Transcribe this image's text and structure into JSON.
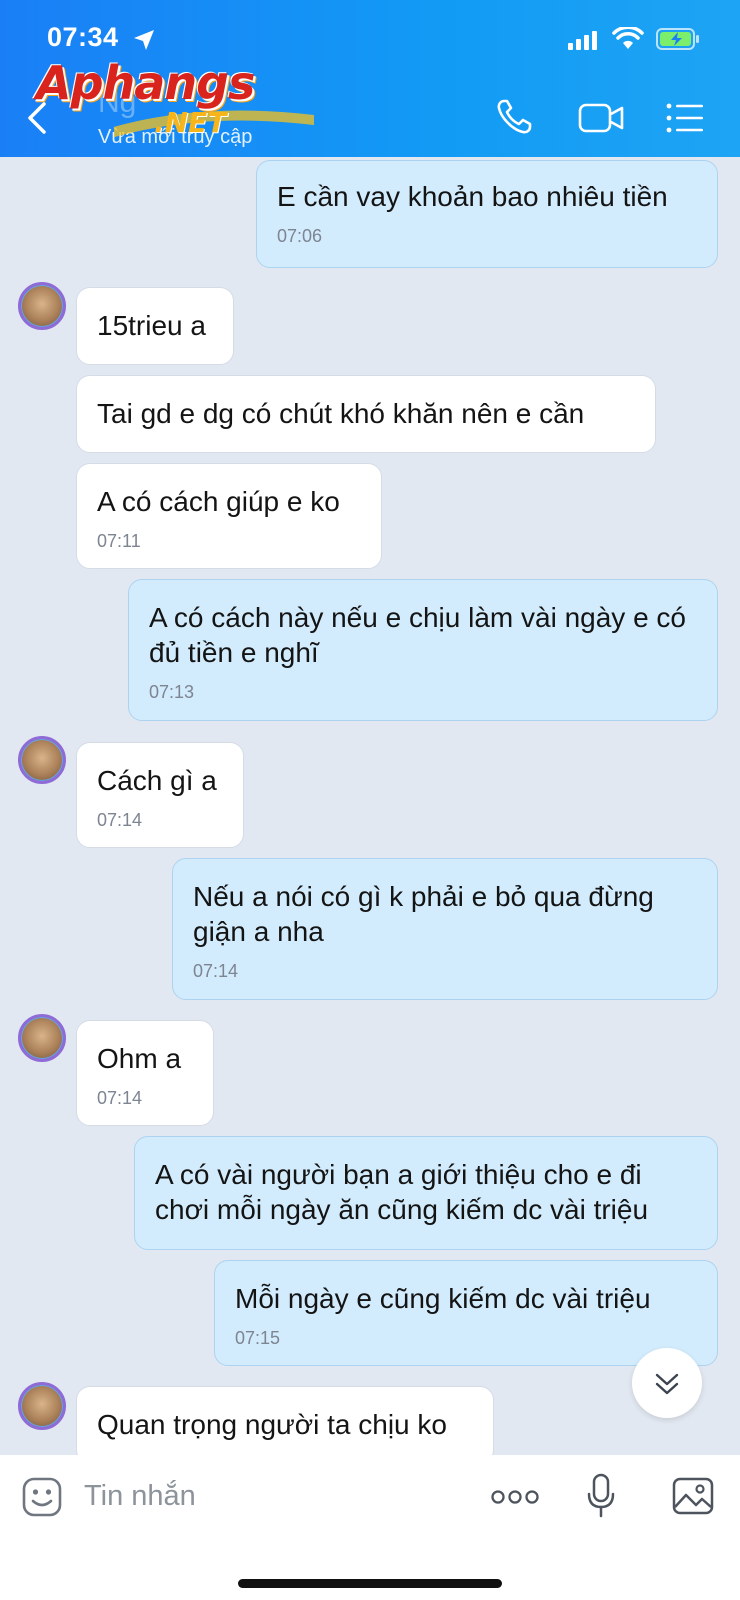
{
  "status_bar": {
    "time": "07:34"
  },
  "header": {
    "contact_name": "Ng",
    "contact_status": "Vừa mới truy cập",
    "watermark_main": "Aphangs",
    "watermark_sub": ".NET"
  },
  "messages": [
    {
      "side": "out",
      "text": "E cần vay khoản bao nhiêu tiền",
      "time": "07:06"
    },
    {
      "side": "in",
      "text": "15trieu a",
      "time": "",
      "avatar": true
    },
    {
      "side": "in",
      "text": "Tai gd e dg có chút khó khăn nên e cần",
      "time": ""
    },
    {
      "side": "in",
      "text": "A có cách giúp e ko",
      "time": "07:11"
    },
    {
      "side": "out",
      "text": "A có cách này nếu e chịu làm vài ngày e có đủ tiền e nghĩ",
      "time": "07:13"
    },
    {
      "side": "in",
      "text": "Cách gì a",
      "time": "07:14",
      "avatar": true
    },
    {
      "side": "out",
      "text": "Nếu a nói có gì k phải e bỏ qua đừng giận a nha",
      "time": "07:14"
    },
    {
      "side": "in",
      "text": "Ohm a",
      "time": "07:14",
      "avatar": true
    },
    {
      "side": "out",
      "text": "A có vài người bạn a giới thiệu cho e đi chơi mỗi ngày ăn cũng kiếm dc vài triệu",
      "time": ""
    },
    {
      "side": "out",
      "text": "Mỗi ngày e cũng kiếm dc vài triệu",
      "time": "07:15"
    },
    {
      "side": "in",
      "text": "Quan trọng người ta chịu ko",
      "time": "",
      "avatar": true
    }
  ],
  "input_bar": {
    "placeholder": "Tin nhắn"
  },
  "icons": {
    "back": "chevron-left-icon",
    "call": "phone-icon",
    "video": "video-camera-icon",
    "menu": "list-menu-icon",
    "scroll": "double-chevron-down-icon",
    "emoji": "emoji-icon",
    "more": "more-dots-icon",
    "mic": "microphone-icon",
    "image": "image-icon"
  },
  "colors": {
    "header": "#1a8cf5",
    "incoming_bubble": "#ffffff",
    "outgoing_bubble": "#d2ecfd",
    "background": "#e2e8f1"
  }
}
